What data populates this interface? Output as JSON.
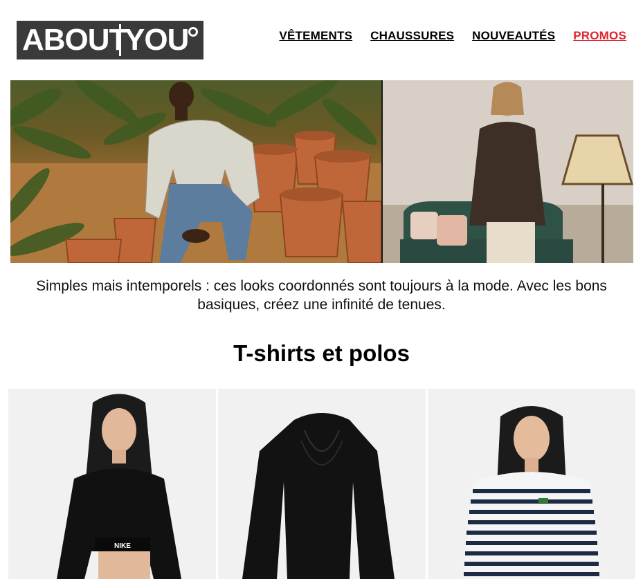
{
  "brand": {
    "logo_text_left": "ABOUT",
    "logo_text_right": "YOU"
  },
  "nav": {
    "items": [
      {
        "label": "VÊTEMENTS"
      },
      {
        "label": "CHAUSSURES"
      },
      {
        "label": "NOUVEAUTÉS"
      },
      {
        "label": "PROMOS"
      }
    ]
  },
  "hero": {
    "left_image": "woman-seated-among-terracotta-pots-photo",
    "right_image": "woman-in-brown-shirt-living-room-photo"
  },
  "intro": {
    "text": "Simples mais intemporels : ces looks coordonnés sont toujours à la mode. Avec les bons basiques, créez une infinité de tenues."
  },
  "section": {
    "title": "T-shirts et polos"
  },
  "products": [
    {
      "image": "black-nike-crop-top-photo",
      "print_text": "NIKE"
    },
    {
      "image": "black-draped-long-sleeve-top-photo"
    },
    {
      "image": "striped-long-sleeve-shirt-photo"
    }
  ],
  "colors": {
    "promo": "#e0222c",
    "logo_bg": "#3a3a3a"
  }
}
